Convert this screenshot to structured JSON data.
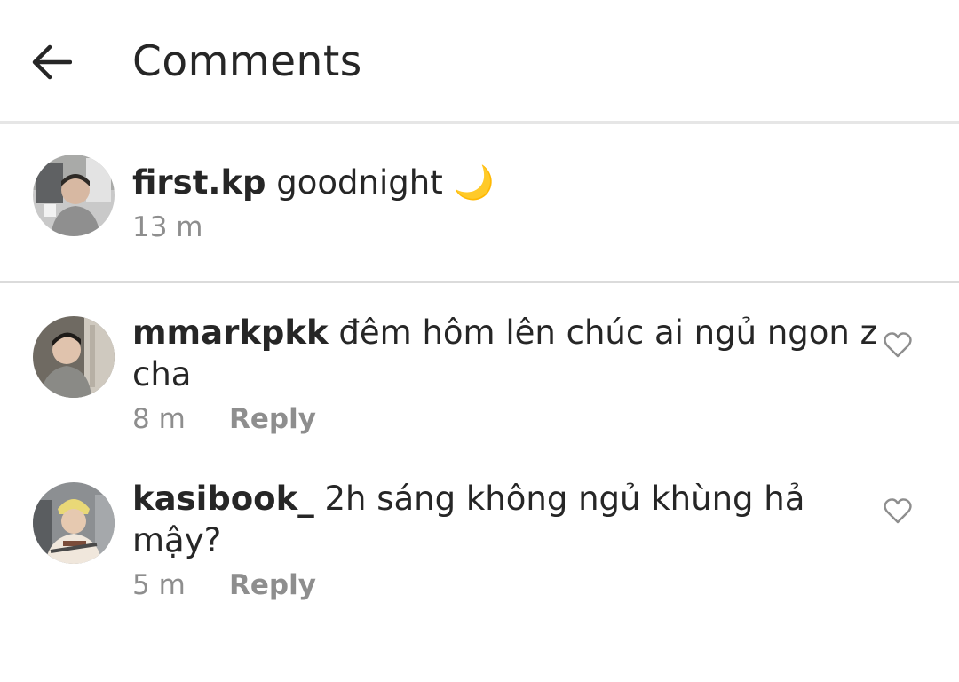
{
  "header": {
    "back_icon": "arrow-left-icon",
    "title": "Comments"
  },
  "caption": {
    "username": "first.kp",
    "text": "goodnight",
    "emoji": "🌙",
    "time": "13 m"
  },
  "comments": [
    {
      "username": "mmarkpkk",
      "text_line1": "đêm hôm lên chúc ai ngủ ngon z",
      "text_line2": "cha",
      "time": "8 m",
      "reply_label": "Reply",
      "like_icon": "heart-outline-icon"
    },
    {
      "username": "kasibook_",
      "text_line1": "2h sáng không ngủ khùng hả",
      "text_line2": "mậy?",
      "time": "5 m",
      "reply_label": "Reply",
      "like_icon": "heart-outline-icon"
    }
  ]
}
